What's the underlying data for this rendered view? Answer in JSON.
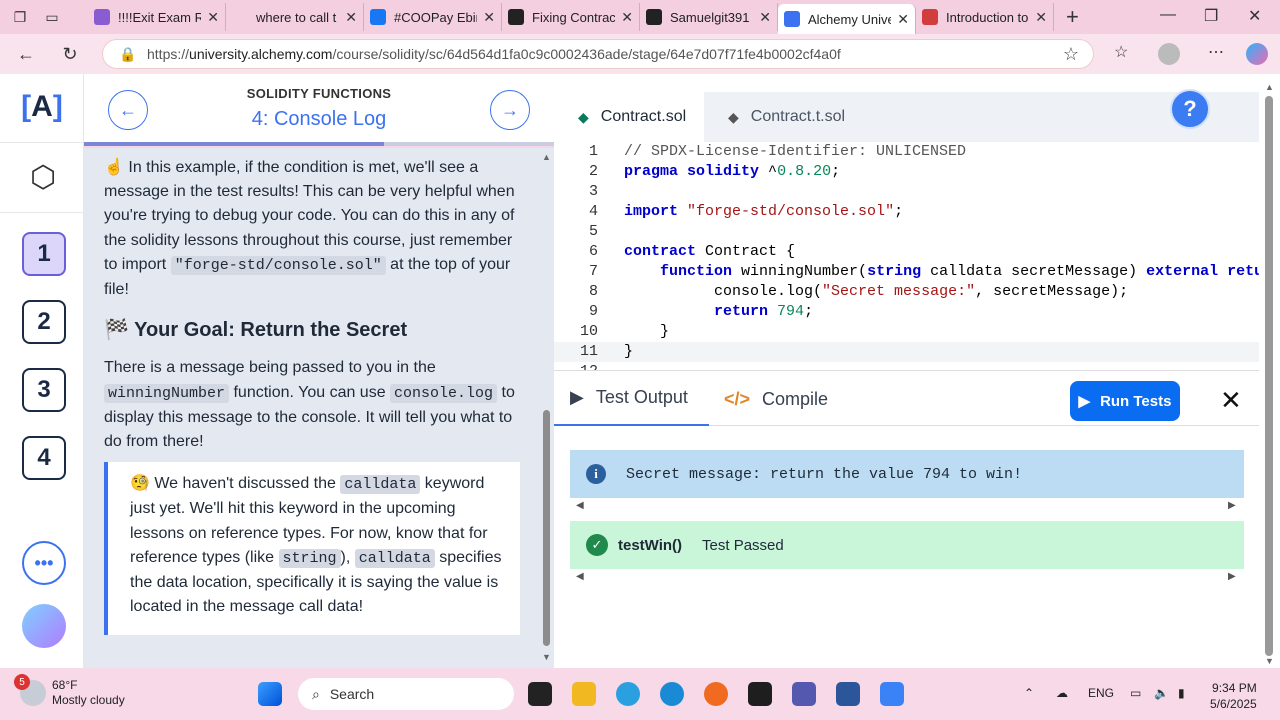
{
  "browser": {
    "tabs": [
      {
        "label": "!!!!Exit Exam Re",
        "color": "#8a5cd1"
      },
      {
        "label": "where to call t",
        "color": "#f3cfe0"
      },
      {
        "label": "#COOPay Ebir",
        "color": "#1877f2"
      },
      {
        "label": "Fixing Contrac",
        "color": "#222222"
      },
      {
        "label": "Samuelgit391",
        "color": "#222222"
      },
      {
        "label": "Alchemy Unive",
        "color": "#3c72f0"
      },
      {
        "label": "Introduction to",
        "color": "#d33c3c"
      }
    ],
    "url_prefix": "https://",
    "url_host": "university.alchemy.com",
    "url_path": "/course/solidity/sc/64d564d1fa0c9c0002436ade/stage/64e7d07f71fe4b0002cf4a0f"
  },
  "sidebar": {
    "logo_text": "A",
    "steps": [
      "1",
      "2",
      "3",
      "4"
    ],
    "more_label": "•••"
  },
  "lesson_header": {
    "subtitle": "SOLIDITY FUNCTIONS",
    "title": "4: Console Log"
  },
  "lesson": {
    "p1_emoji": "☝️",
    "p1_text": " In this example, if the condition is met, we'll see a message in the test results! This can be very helpful when you're trying to debug your code. You can do this in any of the solidity lessons throughout this course, just remember to import ",
    "p1_code": "\"forge-std/console.sol\"",
    "p1_end": " at the top of your file!",
    "goal_icon": "🏁",
    "goal_title": "Your Goal: Return the Secret",
    "p2_a": "There is a message being passed to you in the ",
    "p2_code1": "winningNumber",
    "p2_b": " function. You can use ",
    "p2_code2": "console.log",
    "p2_c": " to display this message to the console. It will tell you what to do from there!",
    "note_emoji": "🧐",
    "note_a": " We haven't discussed the ",
    "note_code1": "calldata",
    "note_b": " keyword just yet. We'll hit this keyword in the upcoming lessons on reference types. For now, know that for reference types (like ",
    "note_code2": "string",
    "note_c": "), ",
    "note_code3": "calldata",
    "note_d": " specifies the data location, specifically it is saying the value is located in the message call data!"
  },
  "editor": {
    "tabs": [
      "Contract.sol",
      "Contract.t.sol"
    ],
    "help_label": "?",
    "lines": [
      {
        "n": "1",
        "html": "<span class=\"cm\">// SPDX-License-Identifier: UNLICENSED</span>"
      },
      {
        "n": "2",
        "html": "<span class=\"kw\">pragma</span> <span class=\"kw\">solidity</span> ^<span class=\"nm\">0.8.20</span>;"
      },
      {
        "n": "3",
        "html": ""
      },
      {
        "n": "4",
        "html": "<span class=\"kw\">import</span> <span class=\"st\">\"forge-std/console.sol\"</span>;"
      },
      {
        "n": "5",
        "html": ""
      },
      {
        "n": "6",
        "html": "<span class=\"kw\">contract</span> Contract {"
      },
      {
        "n": "7",
        "html": "    <span class=\"kw\">function</span> winningNumber(<span class=\"kw\">string</span> calldata secretMessage) <span class=\"kw\">external</span> <span class=\"kw\">returns</span>"
      },
      {
        "n": "8",
        "html": "          console.log(<span class=\"st\">\"Secret message:\"</span>, secretMessage);"
      },
      {
        "n": "9",
        "html": "          <span class=\"kw\">return</span> <span class=\"nm\">794</span>;"
      },
      {
        "n": "10",
        "html": "    }"
      },
      {
        "n": "11",
        "html": "}"
      },
      {
        "n": "12",
        "html": ""
      }
    ]
  },
  "output": {
    "tab_test": "Test Output",
    "tab_compile": "Compile",
    "run_label": "Run Tests",
    "message": "Secret message: return the value 794 to win!",
    "test_name": "testWin()",
    "test_status": "Test Passed"
  },
  "taskbar": {
    "weather_temp": "68°F",
    "weather_desc": "Mostly cloudy",
    "weather_badge": "5",
    "search_label": "Search",
    "lang": "ENG",
    "time": "9:34 PM",
    "date": "5/6/2025"
  }
}
